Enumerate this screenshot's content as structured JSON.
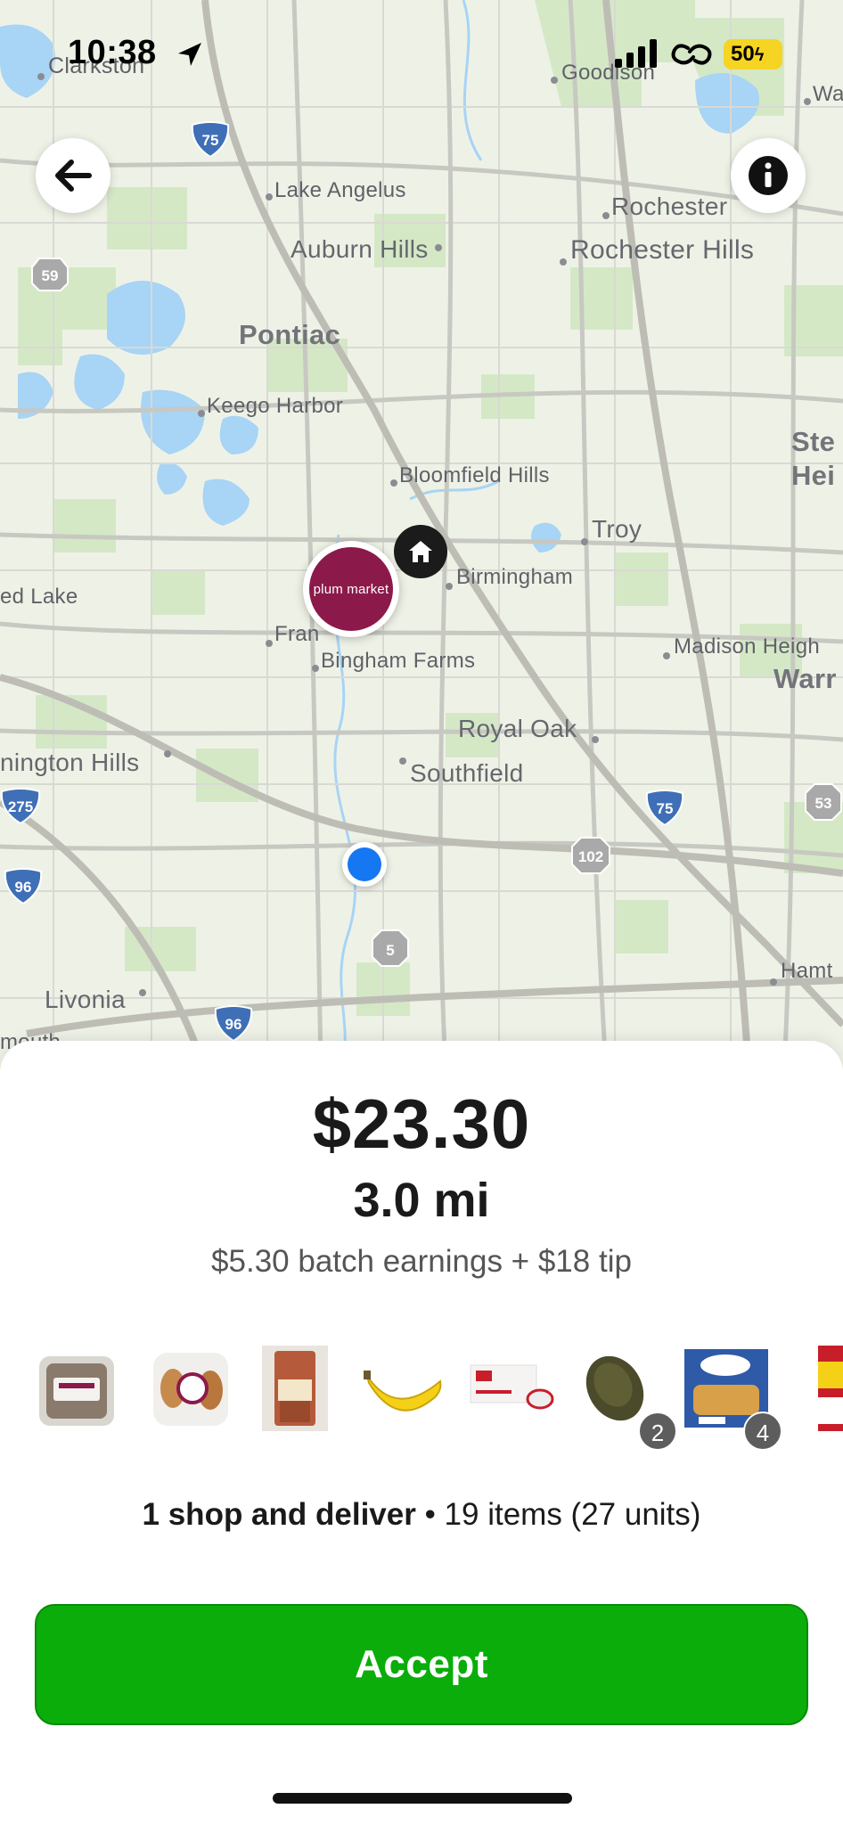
{
  "status_bar": {
    "time": "10:38",
    "battery": "50",
    "icons": [
      "location-arrow-icon",
      "signal-icon",
      "link-icon",
      "battery-charging-icon"
    ]
  },
  "map": {
    "places": {
      "clarkston": "Clarkston",
      "goodison": "Goodison",
      "wa": "Wa",
      "lake_angelus": "Lake Angelus",
      "rochester": "Rochester",
      "auburn_hills": "Auburn Hills",
      "rochester_hills": "Rochester Hills",
      "pontiac": "Pontiac",
      "keego_harbor": "Keego Harbor",
      "sterling_heights_1": "Ste",
      "sterling_heights_2": "Hei",
      "bloomfield_hills": "Bloomfield Hills",
      "troy": "Troy",
      "birmingham": "Birmingham",
      "walled_lake": "ed Lake",
      "franklin": "Fran",
      "bingham_farms": "Bingham Farms",
      "madison_heights": "Madison Heigh",
      "warren": "Warr",
      "royal_oak": "Royal Oak",
      "farmington_hills": "nington Hills",
      "southfield": "Southfield",
      "hamtramck": "Hamt",
      "livonia": "Livonia",
      "plymouth": "mouth"
    },
    "shields": {
      "i75_top": "75",
      "m59": "59",
      "i275": "275",
      "i96_left": "96",
      "i75_mid": "75",
      "m102": "102",
      "m53": "53",
      "m5": "5",
      "i96_bottom": "96"
    },
    "store_pin": "plum market",
    "colors": {
      "store": "#8b1a4a",
      "me": "#1677f2",
      "water": "#a8d4f5",
      "park": "#cfe5c0"
    }
  },
  "offer": {
    "price": "$23.30",
    "distance": "3.0 mi",
    "breakdown": "$5.30 batch earnings + $18 tip",
    "items": [
      {
        "name": "packaged-dessert",
        "badge": ""
      },
      {
        "name": "packaged-cookies",
        "badge": ""
      },
      {
        "name": "granola-bag",
        "badge": ""
      },
      {
        "name": "banana",
        "badge": ""
      },
      {
        "name": "coffee-pods-box",
        "badge": ""
      },
      {
        "name": "avocado",
        "badge": "2"
      },
      {
        "name": "fish-sticks-box",
        "badge": "4"
      },
      {
        "name": "milk-carton",
        "badge": ""
      }
    ],
    "summary_bold": "1 shop and deliver",
    "summary_rest": " • 19 items (27 units)",
    "accept_label": "Accept",
    "accent": "#0aad0a"
  }
}
